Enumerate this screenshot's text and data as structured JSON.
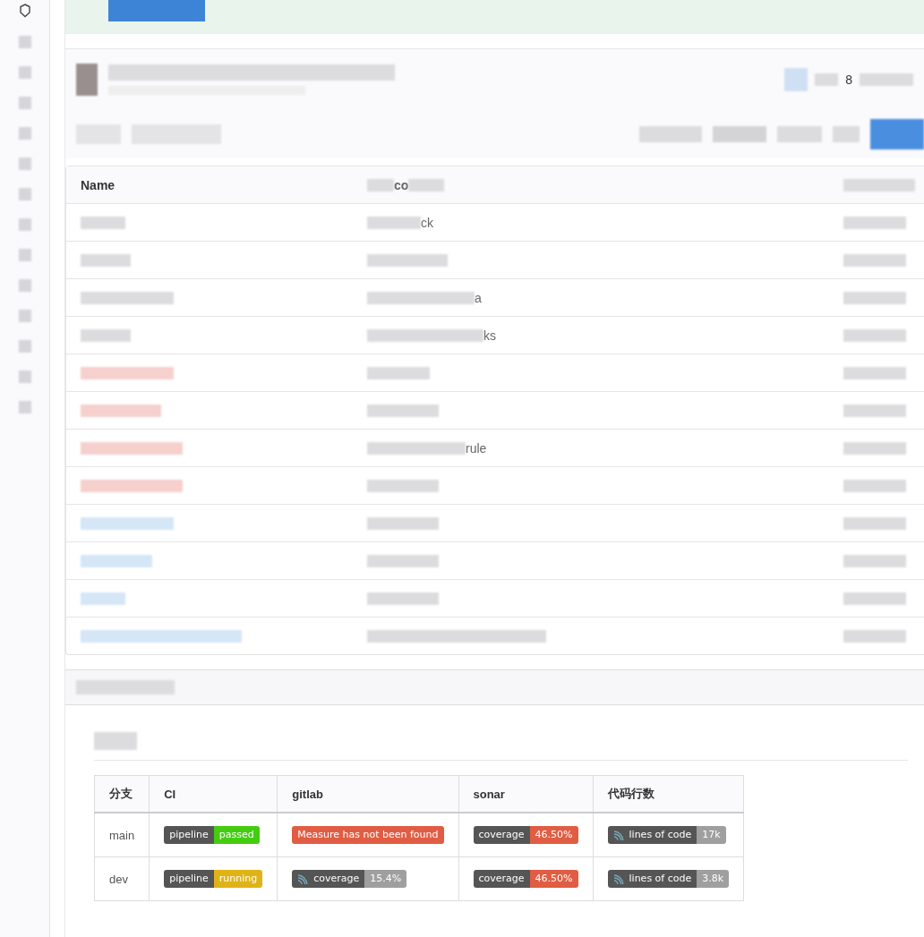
{
  "header": {
    "count": "8"
  },
  "file_table": {
    "columns": [
      "Name",
      "co"
    ],
    "rows": [
      {
        "message": "ck"
      },
      {
        "message": ""
      },
      {
        "message": "a"
      },
      {
        "message": "ks"
      },
      {
        "message": ""
      },
      {
        "message": ""
      },
      {
        "message": "rule"
      },
      {
        "message": ""
      },
      {
        "message": ""
      },
      {
        "message": ""
      },
      {
        "message": ""
      },
      {
        "message": ""
      }
    ]
  },
  "readme": {
    "table": {
      "columns": [
        "分支",
        "CI",
        "gitlab",
        "sonar",
        "代码行数"
      ],
      "rows": [
        {
          "cells": [
            {
              "kind": "text",
              "value": "main"
            },
            {
              "kind": "pair",
              "label": "pipeline",
              "value": "passed",
              "color": "#44cc11"
            },
            {
              "kind": "message",
              "value": "Measure has not been found",
              "color": "#e05d44"
            },
            {
              "kind": "pair",
              "label": "coverage",
              "value": "46.50%",
              "color": "#e05d44"
            },
            {
              "kind": "icon_pair",
              "label": "lines of code",
              "value": "17k",
              "color": "#9f9f9f"
            }
          ]
        },
        {
          "cells": [
            {
              "kind": "text",
              "value": "dev"
            },
            {
              "kind": "pair",
              "label": "pipeline",
              "value": "running",
              "color": "#dfb317"
            },
            {
              "kind": "icon_pair",
              "label": "coverage",
              "value": "15.4%",
              "color": "#9f9f9f"
            },
            {
              "kind": "pair",
              "label": "coverage",
              "value": "46.50%",
              "color": "#e05d44"
            },
            {
              "kind": "icon_pair",
              "label": "lines of code",
              "value": "3.8k",
              "color": "#9f9f9f"
            }
          ]
        }
      ]
    }
  }
}
